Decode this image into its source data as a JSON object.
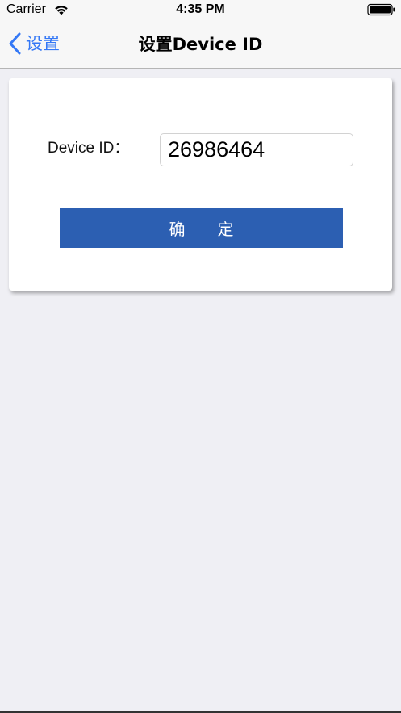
{
  "status_bar": {
    "carrier": "Carrier",
    "time": "4:35 PM",
    "wifi_icon": "wifi-icon",
    "battery_icon": "battery-icon"
  },
  "nav_bar": {
    "back_label": "设置",
    "back_icon": "chevron-left-icon",
    "title": "设置Device ID"
  },
  "form": {
    "device_id_label": "Device ID：",
    "device_id_value": "26986464",
    "confirm_label": "确　　定"
  },
  "colors": {
    "accent": "#3478f6",
    "button": "#2c5fb2",
    "background": "#efeff4"
  }
}
